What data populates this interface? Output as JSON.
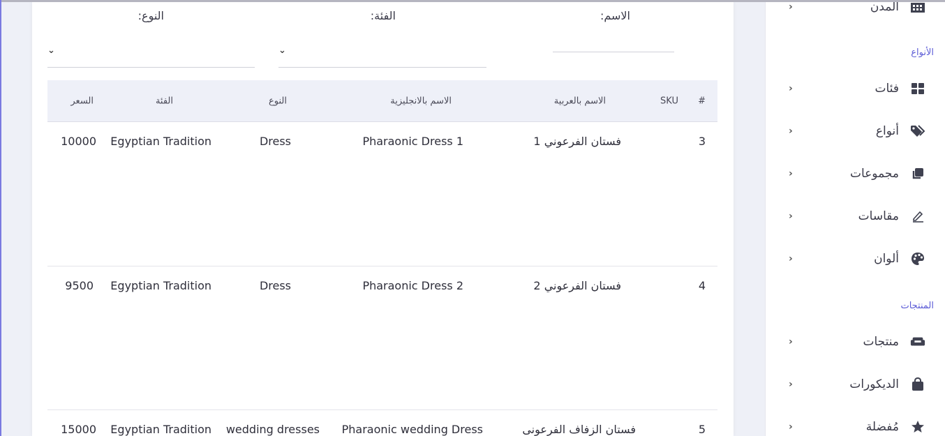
{
  "filters": {
    "name_label": "الاسم:",
    "category_label": "الفئة:",
    "type_label": "النوع:"
  },
  "table": {
    "headers": {
      "index": "#",
      "sku": "SKU",
      "name_ar": "الاسم بالعربية",
      "name_en": "الاسم بالانجليزية",
      "type": "النوع",
      "category": "الفئة",
      "price": "السعر"
    },
    "rows": [
      {
        "index": "3",
        "sku": "",
        "name_ar": "فستان الفرعوني 1",
        "name_en": "Pharaonic Dress 1",
        "type": "Dress",
        "category": "Egyptian Tradition",
        "price": "10000"
      },
      {
        "index": "4",
        "sku": "",
        "name_ar": "فستان الفرعوني 2",
        "name_en": "Pharaonic Dress 2",
        "type": "Dress",
        "category": "Egyptian Tradition",
        "price": "9500"
      },
      {
        "index": "5",
        "sku": "",
        "name_ar": "فستان الزفاف الفرعونى",
        "name_en": "Pharaonic wedding Dress",
        "type": "wedding dresses",
        "category": "Egyptian Tradition",
        "price": "15000"
      }
    ]
  },
  "sidebar": {
    "top_item": {
      "label": "المدن",
      "icon": "city-icon"
    },
    "sections": [
      {
        "title": "الأنواع"
      },
      {
        "title": "المنتجات"
      }
    ],
    "types_items": [
      {
        "label": "فئات",
        "icon": "grid-icon"
      },
      {
        "label": "أنواع",
        "icon": "tags-icon"
      },
      {
        "label": "مجموعات",
        "icon": "clone-icon"
      },
      {
        "label": "مقاسات",
        "icon": "pencil-icon"
      },
      {
        "label": "ألوان",
        "icon": "palette-icon"
      }
    ],
    "products_items": [
      {
        "label": "منتجات",
        "icon": "couch-icon"
      },
      {
        "label": "الديكورات",
        "icon": "bag-icon"
      },
      {
        "label": "مُفضلة",
        "icon": "star-icon"
      }
    ]
  },
  "colors": {
    "accent": "#5b5bd6",
    "header_bg": "#eef0f8",
    "page_bg": "#eef0f7",
    "icon": "#3f4150"
  }
}
